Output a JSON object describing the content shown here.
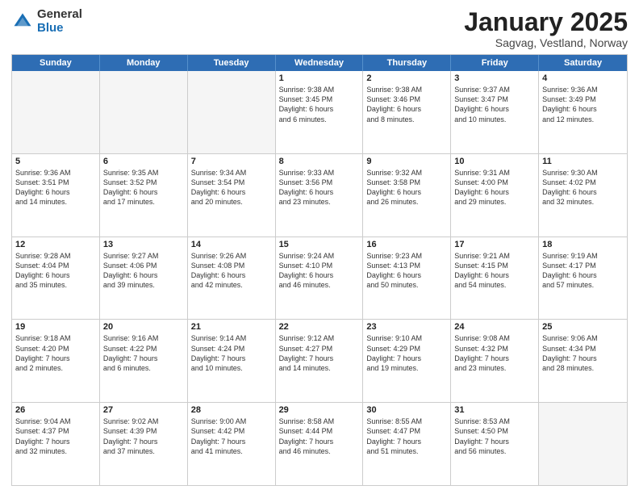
{
  "header": {
    "logo_general": "General",
    "logo_blue": "Blue",
    "title": "January 2025",
    "location": "Sagvag, Vestland, Norway"
  },
  "days_of_week": [
    "Sunday",
    "Monday",
    "Tuesday",
    "Wednesday",
    "Thursday",
    "Friday",
    "Saturday"
  ],
  "weeks": [
    [
      {
        "day": "",
        "text": "",
        "empty": true
      },
      {
        "day": "",
        "text": "",
        "empty": true
      },
      {
        "day": "",
        "text": "",
        "empty": true
      },
      {
        "day": "1",
        "text": "Sunrise: 9:38 AM\nSunset: 3:45 PM\nDaylight: 6 hours\nand 6 minutes.",
        "empty": false
      },
      {
        "day": "2",
        "text": "Sunrise: 9:38 AM\nSunset: 3:46 PM\nDaylight: 6 hours\nand 8 minutes.",
        "empty": false
      },
      {
        "day": "3",
        "text": "Sunrise: 9:37 AM\nSunset: 3:47 PM\nDaylight: 6 hours\nand 10 minutes.",
        "empty": false
      },
      {
        "day": "4",
        "text": "Sunrise: 9:36 AM\nSunset: 3:49 PM\nDaylight: 6 hours\nand 12 minutes.",
        "empty": false
      }
    ],
    [
      {
        "day": "5",
        "text": "Sunrise: 9:36 AM\nSunset: 3:51 PM\nDaylight: 6 hours\nand 14 minutes.",
        "empty": false
      },
      {
        "day": "6",
        "text": "Sunrise: 9:35 AM\nSunset: 3:52 PM\nDaylight: 6 hours\nand 17 minutes.",
        "empty": false
      },
      {
        "day": "7",
        "text": "Sunrise: 9:34 AM\nSunset: 3:54 PM\nDaylight: 6 hours\nand 20 minutes.",
        "empty": false
      },
      {
        "day": "8",
        "text": "Sunrise: 9:33 AM\nSunset: 3:56 PM\nDaylight: 6 hours\nand 23 minutes.",
        "empty": false
      },
      {
        "day": "9",
        "text": "Sunrise: 9:32 AM\nSunset: 3:58 PM\nDaylight: 6 hours\nand 26 minutes.",
        "empty": false
      },
      {
        "day": "10",
        "text": "Sunrise: 9:31 AM\nSunset: 4:00 PM\nDaylight: 6 hours\nand 29 minutes.",
        "empty": false
      },
      {
        "day": "11",
        "text": "Sunrise: 9:30 AM\nSunset: 4:02 PM\nDaylight: 6 hours\nand 32 minutes.",
        "empty": false
      }
    ],
    [
      {
        "day": "12",
        "text": "Sunrise: 9:28 AM\nSunset: 4:04 PM\nDaylight: 6 hours\nand 35 minutes.",
        "empty": false
      },
      {
        "day": "13",
        "text": "Sunrise: 9:27 AM\nSunset: 4:06 PM\nDaylight: 6 hours\nand 39 minutes.",
        "empty": false
      },
      {
        "day": "14",
        "text": "Sunrise: 9:26 AM\nSunset: 4:08 PM\nDaylight: 6 hours\nand 42 minutes.",
        "empty": false
      },
      {
        "day": "15",
        "text": "Sunrise: 9:24 AM\nSunset: 4:10 PM\nDaylight: 6 hours\nand 46 minutes.",
        "empty": false
      },
      {
        "day": "16",
        "text": "Sunrise: 9:23 AM\nSunset: 4:13 PM\nDaylight: 6 hours\nand 50 minutes.",
        "empty": false
      },
      {
        "day": "17",
        "text": "Sunrise: 9:21 AM\nSunset: 4:15 PM\nDaylight: 6 hours\nand 54 minutes.",
        "empty": false
      },
      {
        "day": "18",
        "text": "Sunrise: 9:19 AM\nSunset: 4:17 PM\nDaylight: 6 hours\nand 57 minutes.",
        "empty": false
      }
    ],
    [
      {
        "day": "19",
        "text": "Sunrise: 9:18 AM\nSunset: 4:20 PM\nDaylight: 7 hours\nand 2 minutes.",
        "empty": false
      },
      {
        "day": "20",
        "text": "Sunrise: 9:16 AM\nSunset: 4:22 PM\nDaylight: 7 hours\nand 6 minutes.",
        "empty": false
      },
      {
        "day": "21",
        "text": "Sunrise: 9:14 AM\nSunset: 4:24 PM\nDaylight: 7 hours\nand 10 minutes.",
        "empty": false
      },
      {
        "day": "22",
        "text": "Sunrise: 9:12 AM\nSunset: 4:27 PM\nDaylight: 7 hours\nand 14 minutes.",
        "empty": false
      },
      {
        "day": "23",
        "text": "Sunrise: 9:10 AM\nSunset: 4:29 PM\nDaylight: 7 hours\nand 19 minutes.",
        "empty": false
      },
      {
        "day": "24",
        "text": "Sunrise: 9:08 AM\nSunset: 4:32 PM\nDaylight: 7 hours\nand 23 minutes.",
        "empty": false
      },
      {
        "day": "25",
        "text": "Sunrise: 9:06 AM\nSunset: 4:34 PM\nDaylight: 7 hours\nand 28 minutes.",
        "empty": false
      }
    ],
    [
      {
        "day": "26",
        "text": "Sunrise: 9:04 AM\nSunset: 4:37 PM\nDaylight: 7 hours\nand 32 minutes.",
        "empty": false
      },
      {
        "day": "27",
        "text": "Sunrise: 9:02 AM\nSunset: 4:39 PM\nDaylight: 7 hours\nand 37 minutes.",
        "empty": false
      },
      {
        "day": "28",
        "text": "Sunrise: 9:00 AM\nSunset: 4:42 PM\nDaylight: 7 hours\nand 41 minutes.",
        "empty": false
      },
      {
        "day": "29",
        "text": "Sunrise: 8:58 AM\nSunset: 4:44 PM\nDaylight: 7 hours\nand 46 minutes.",
        "empty": false
      },
      {
        "day": "30",
        "text": "Sunrise: 8:55 AM\nSunset: 4:47 PM\nDaylight: 7 hours\nand 51 minutes.",
        "empty": false
      },
      {
        "day": "31",
        "text": "Sunrise: 8:53 AM\nSunset: 4:50 PM\nDaylight: 7 hours\nand 56 minutes.",
        "empty": false
      },
      {
        "day": "",
        "text": "",
        "empty": true
      }
    ]
  ]
}
